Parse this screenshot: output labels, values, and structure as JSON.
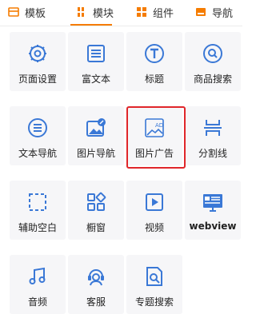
{
  "tabs": [
    {
      "label": "模板",
      "icon": "template-icon",
      "color": "#f57c00"
    },
    {
      "label": "模块",
      "icon": "module-icon",
      "color": "#f57c00"
    },
    {
      "label": "组件",
      "icon": "component-icon",
      "color": "#f57c00"
    },
    {
      "label": "导航",
      "icon": "navigation-icon",
      "color": "#f57c00"
    }
  ],
  "active_tab": "模块",
  "colors": {
    "accent": "#f57c00",
    "icon_blue": "#3a78d6",
    "highlight": "#e0262a"
  },
  "modules": [
    {
      "label": "页面设置",
      "icon": "gear-icon"
    },
    {
      "label": "富文本",
      "icon": "rich-text-icon"
    },
    {
      "label": "标题",
      "icon": "title-icon"
    },
    {
      "label": "商品搜索",
      "icon": "search-icon"
    },
    {
      "label": "文本导航",
      "icon": "text-nav-icon"
    },
    {
      "label": "图片导航",
      "icon": "image-nav-icon"
    },
    {
      "label": "图片广告",
      "icon": "image-ad-icon"
    },
    {
      "label": "分割线",
      "icon": "divider-icon"
    },
    {
      "label": "辅助空白",
      "icon": "blank-space-icon"
    },
    {
      "label": "橱窗",
      "icon": "showcase-icon"
    },
    {
      "label": "视频",
      "icon": "video-icon"
    },
    {
      "label": "webview",
      "icon": "webview-icon"
    },
    {
      "label": "音频",
      "icon": "audio-icon"
    },
    {
      "label": "客服",
      "icon": "customer-service-icon"
    },
    {
      "label": "专题搜索",
      "icon": "topic-search-icon"
    }
  ],
  "ad_badge": "AD"
}
